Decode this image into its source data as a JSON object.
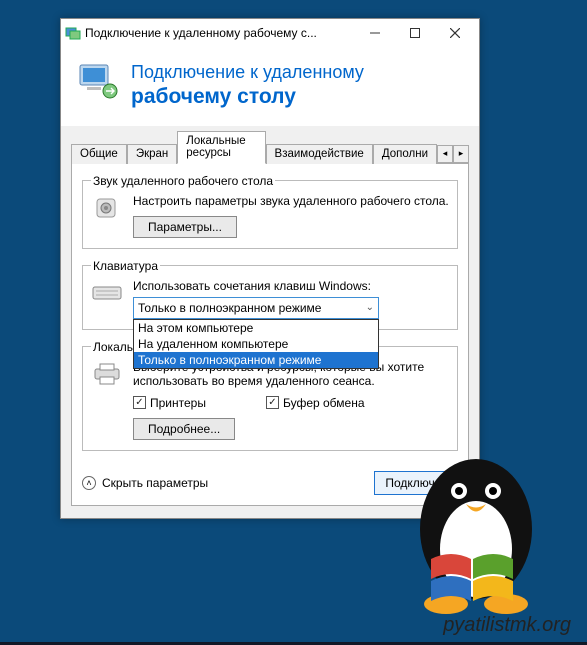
{
  "window": {
    "title": "Подключение к удаленному рабочему с..."
  },
  "header": {
    "line1": "Подключение к удаленному",
    "line2": "рабочему столу"
  },
  "tabs": {
    "items": [
      "Общие",
      "Экран",
      "Локальные ресурсы",
      "Взаимодействие",
      "Дополни"
    ],
    "active_index": 2
  },
  "audio": {
    "legend": "Звук удаленного рабочего стола",
    "desc": "Настроить параметры звука удаленного рабочего стола.",
    "settings_btn": "Параметры..."
  },
  "keyboard": {
    "legend": "Клавиатура",
    "desc": "Использовать сочетания клавиш Windows:",
    "selected": "Только в полноэкранном режиме",
    "options": [
      "На этом компьютере",
      "На удаленном компьютере",
      "Только в полноэкранном режиме"
    ],
    "selected_index": 2
  },
  "local": {
    "legend": "Локальные устройства и ресурсы",
    "desc": "Выберите устройства и ресурсы, которые вы хотите использовать во время удаленного сеанса.",
    "printers": "Принтеры",
    "clipboard": "Буфер обмена",
    "more_btn": "Подробнее..."
  },
  "footer": {
    "hide": "Скрыть параметры",
    "connect": "Подключит"
  },
  "watermark": "pyatilistmk.org"
}
